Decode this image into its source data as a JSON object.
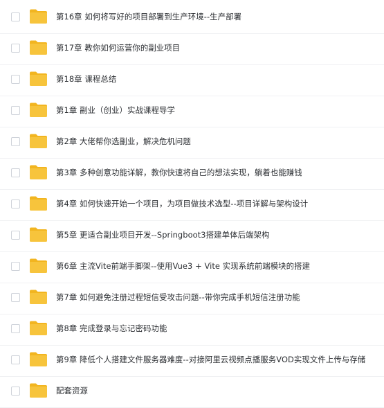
{
  "colors": {
    "folder": "#f7c43c",
    "folder_tab": "#f2b520",
    "text": "#2c2f33",
    "divider": "#f0f1f3",
    "checkbox_border": "#cfd3da"
  },
  "items": [
    {
      "name": "第16章 如何将写好的项目部署到生产环境--生产部署",
      "icon": "folder-icon"
    },
    {
      "name": "第17章 教你如何运营你的副业项目",
      "icon": "folder-icon"
    },
    {
      "name": "第18章 课程总结",
      "icon": "folder-icon"
    },
    {
      "name": "第1章 副业（创业）实战课程导学",
      "icon": "folder-icon"
    },
    {
      "name": "第2章 大佬帮你选副业，解决危机问题",
      "icon": "folder-icon"
    },
    {
      "name": "第3章 多种创意功能详解，教你快速将自己的想法实现，躺着也能赚钱",
      "icon": "folder-icon"
    },
    {
      "name": "第4章 如何快速开始一个项目，为项目做技术选型--项目详解与架构设计",
      "icon": "folder-icon"
    },
    {
      "name": "第5章 更适合副业项目开发--Springboot3搭建单体后端架构",
      "icon": "folder-icon"
    },
    {
      "name": "第6章 主流Vite前端手脚架--使用Vue3 + Vite 实现系统前端模块的搭建",
      "icon": "folder-icon"
    },
    {
      "name": "第7章 如何避免注册过程短信受攻击问题--带你完成手机短信注册功能",
      "icon": "folder-icon"
    },
    {
      "name": "第8章 完成登录与忘记密码功能",
      "icon": "folder-icon"
    },
    {
      "name": "第9章 降低个人搭建文件服务器难度--对接阿里云视频点播服务VOD实现文件上传与存储",
      "icon": "folder-icon"
    },
    {
      "name": "配套资源",
      "icon": "folder-icon"
    }
  ]
}
